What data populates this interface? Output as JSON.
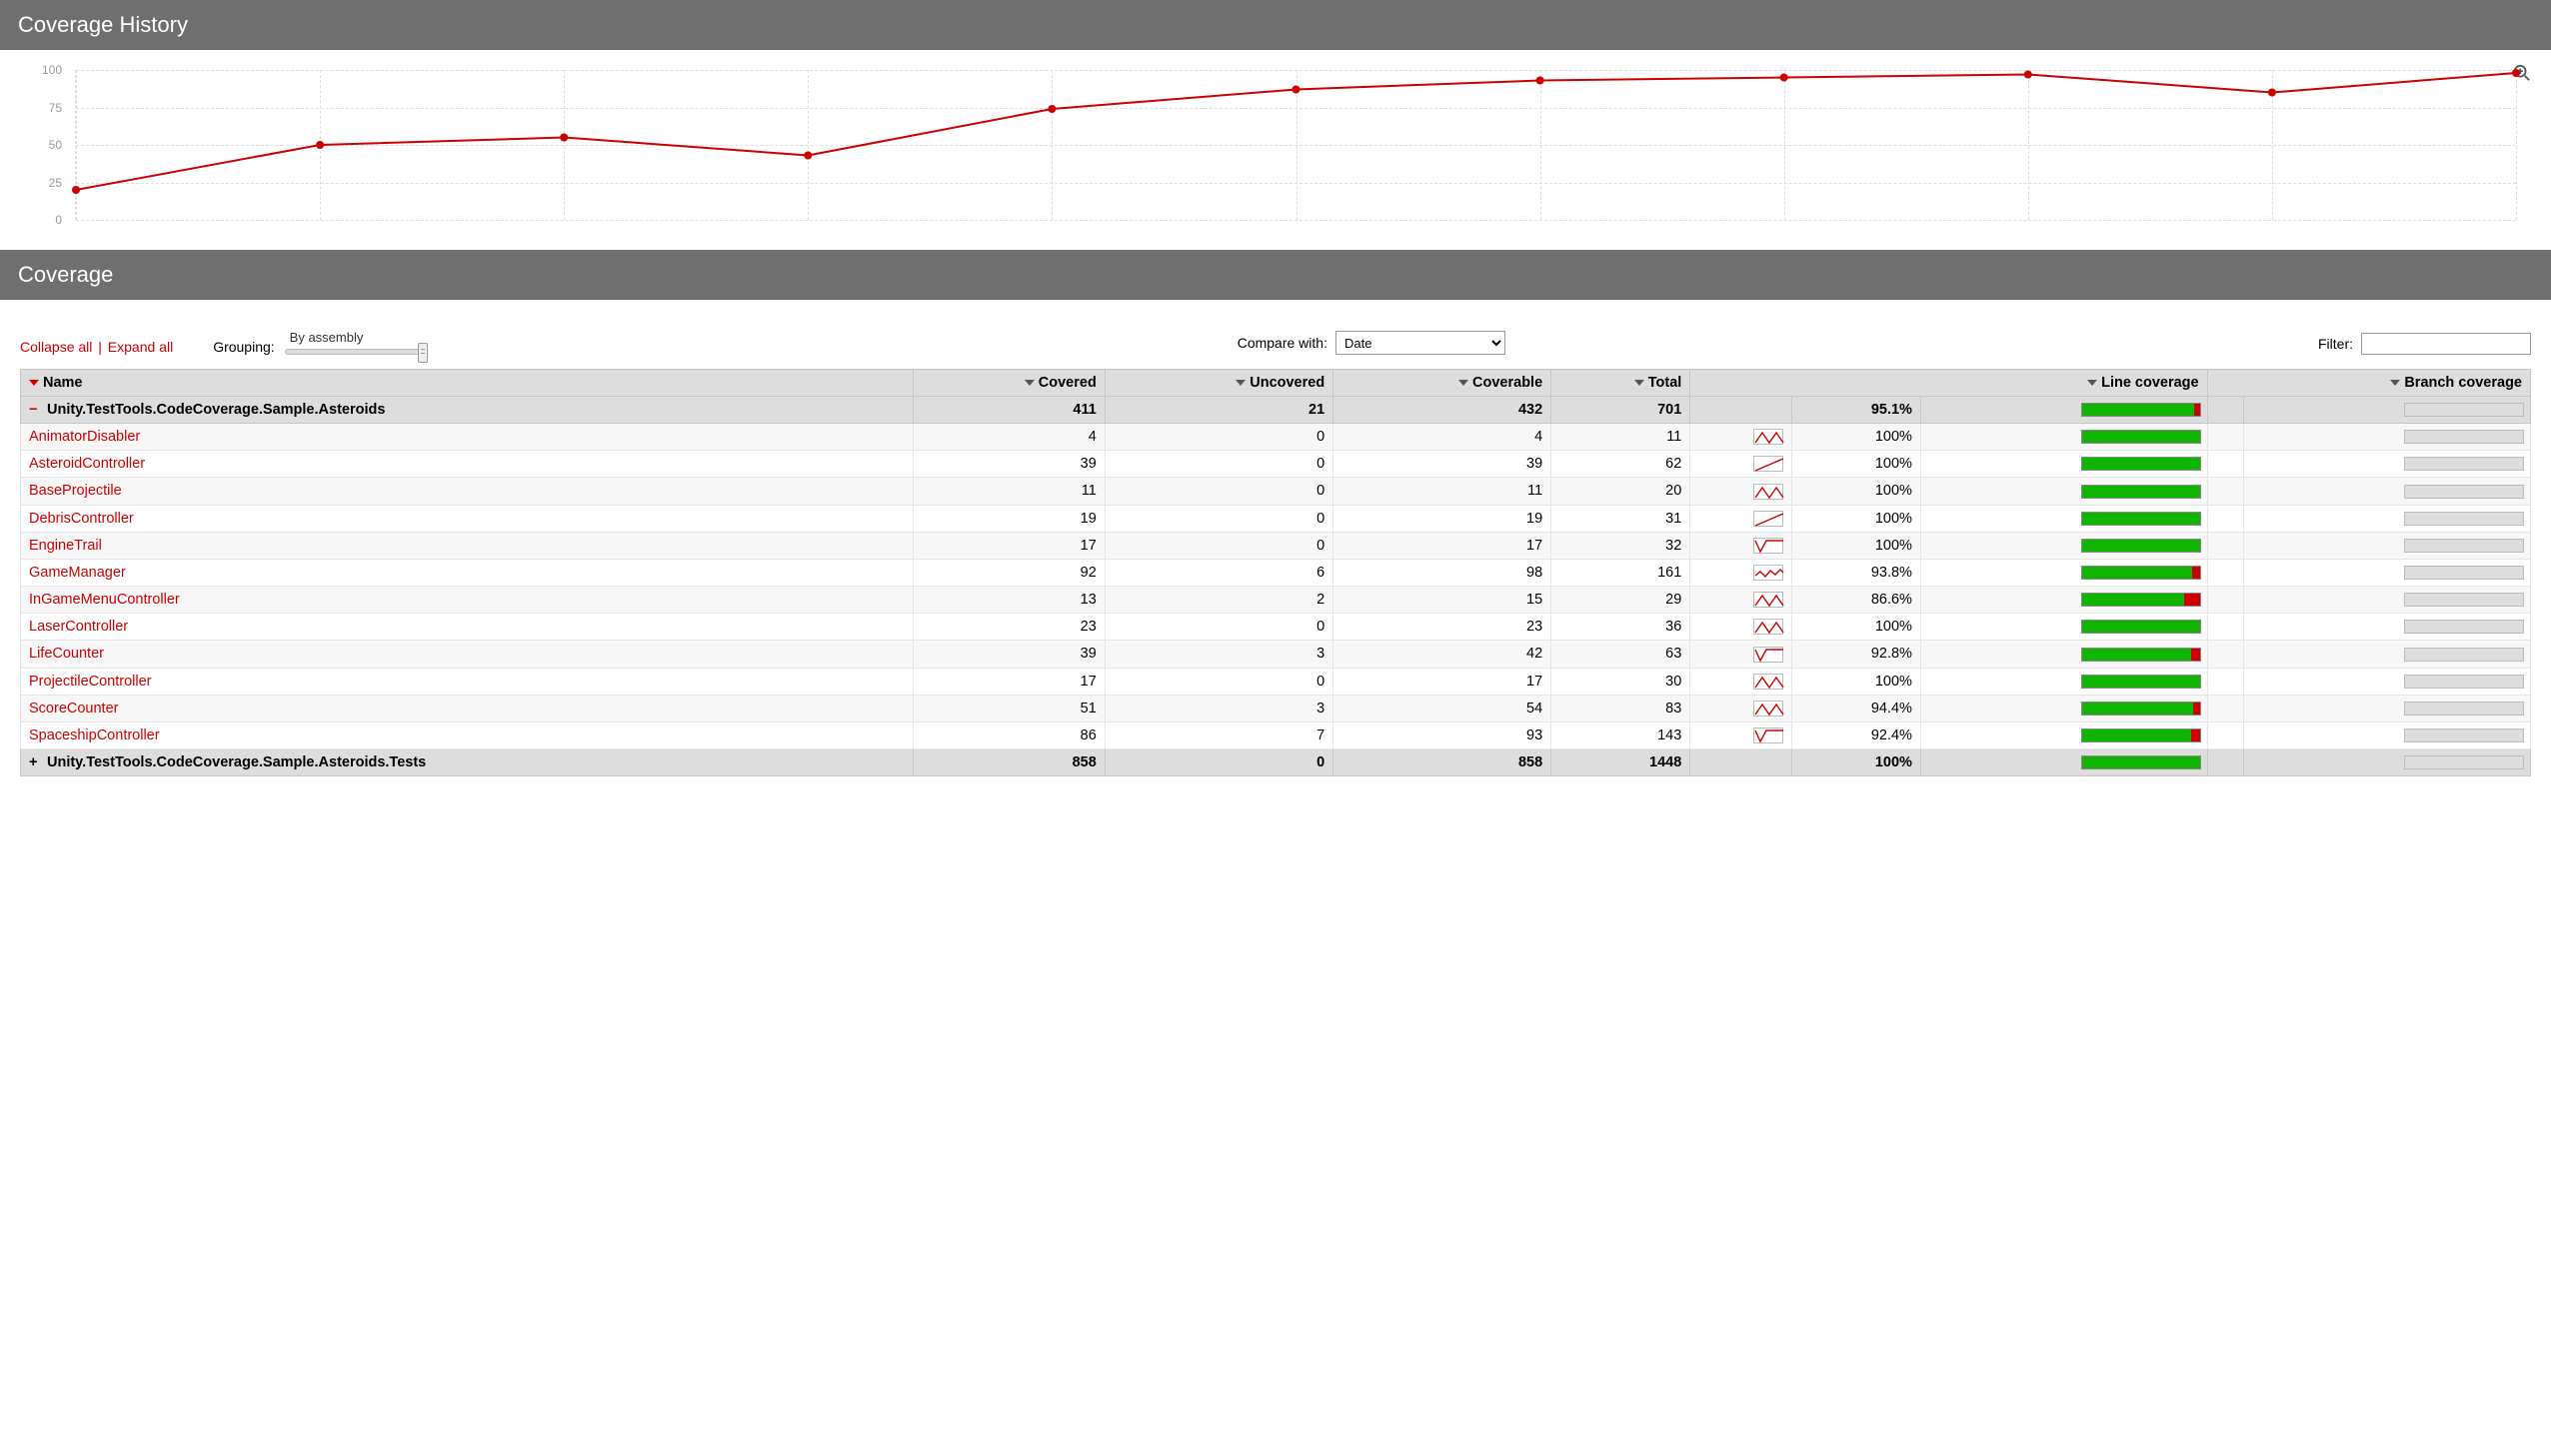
{
  "historyHeader": "Coverage History",
  "coverageHeader": "Coverage",
  "collapseAll": "Collapse all",
  "expandAll": "Expand all",
  "groupingLabel": "Grouping:",
  "groupingMode": "By assembly",
  "compareLabel": "Compare with:",
  "compareValue": "Date",
  "filterLabel": "Filter:",
  "filterValue": "",
  "columns": {
    "name": "Name",
    "covered": "Covered",
    "uncovered": "Uncovered",
    "coverable": "Coverable",
    "total": "Total",
    "lineCoverage": "Line coverage",
    "branchCoverage": "Branch coverage"
  },
  "chart_data": {
    "type": "line",
    "title": "Coverage History",
    "ylabel": "",
    "xlabel": "",
    "ylim": [
      0,
      100
    ],
    "yticks": [
      0,
      25,
      50,
      75,
      100
    ],
    "x": [
      0,
      1,
      2,
      3,
      4,
      5,
      6,
      7,
      8,
      9,
      10
    ],
    "values": [
      20,
      50,
      55,
      43,
      74,
      87,
      93,
      95,
      97,
      85,
      98
    ],
    "color": "#cc0000"
  },
  "assemblies": [
    {
      "expanded": true,
      "name": "Unity.TestTools.CodeCoverage.Sample.Asteroids",
      "covered": 411,
      "uncovered": 21,
      "coverable": 432,
      "total": 701,
      "pct": "95.1%",
      "pctVal": 95.1,
      "classes": [
        {
          "name": "AnimatorDisabler",
          "covered": 4,
          "uncovered": 0,
          "coverable": 4,
          "total": 11,
          "pct": "100%",
          "pctVal": 100,
          "spark": "zigzag"
        },
        {
          "name": "AsteroidController",
          "covered": 39,
          "uncovered": 0,
          "coverable": 39,
          "total": 62,
          "pct": "100%",
          "pctVal": 100,
          "spark": "rise"
        },
        {
          "name": "BaseProjectile",
          "covered": 11,
          "uncovered": 0,
          "coverable": 11,
          "total": 20,
          "pct": "100%",
          "pctVal": 100,
          "spark": "zigzag"
        },
        {
          "name": "DebrisController",
          "covered": 19,
          "uncovered": 0,
          "coverable": 19,
          "total": 31,
          "pct": "100%",
          "pctVal": 100,
          "spark": "rise"
        },
        {
          "name": "EngineTrail",
          "covered": 17,
          "uncovered": 0,
          "coverable": 17,
          "total": 32,
          "pct": "100%",
          "pctVal": 100,
          "spark": "dip"
        },
        {
          "name": "GameManager",
          "covered": 92,
          "uncovered": 6,
          "coverable": 98,
          "total": 161,
          "pct": "93.8%",
          "pctVal": 93.8,
          "spark": "wavy"
        },
        {
          "name": "InGameMenuController",
          "covered": 13,
          "uncovered": 2,
          "coverable": 15,
          "total": 29,
          "pct": "86.6%",
          "pctVal": 86.6,
          "spark": "zigzag"
        },
        {
          "name": "LaserController",
          "covered": 23,
          "uncovered": 0,
          "coverable": 23,
          "total": 36,
          "pct": "100%",
          "pctVal": 100,
          "spark": "zigzag"
        },
        {
          "name": "LifeCounter",
          "covered": 39,
          "uncovered": 3,
          "coverable": 42,
          "total": 63,
          "pct": "92.8%",
          "pctVal": 92.8,
          "spark": "dip"
        },
        {
          "name": "ProjectileController",
          "covered": 17,
          "uncovered": 0,
          "coverable": 17,
          "total": 30,
          "pct": "100%",
          "pctVal": 100,
          "spark": "zigzag"
        },
        {
          "name": "ScoreCounter",
          "covered": 51,
          "uncovered": 3,
          "coverable": 54,
          "total": 83,
          "pct": "94.4%",
          "pctVal": 94.4,
          "spark": "zigzag"
        },
        {
          "name": "SpaceshipController",
          "covered": 86,
          "uncovered": 7,
          "coverable": 93,
          "total": 143,
          "pct": "92.4%",
          "pctVal": 92.4,
          "spark": "dip"
        }
      ]
    },
    {
      "expanded": false,
      "name": "Unity.TestTools.CodeCoverage.Sample.Asteroids.Tests",
      "covered": 858,
      "uncovered": 0,
      "coverable": 858,
      "total": 1448,
      "pct": "100%",
      "pctVal": 100,
      "classes": []
    }
  ]
}
